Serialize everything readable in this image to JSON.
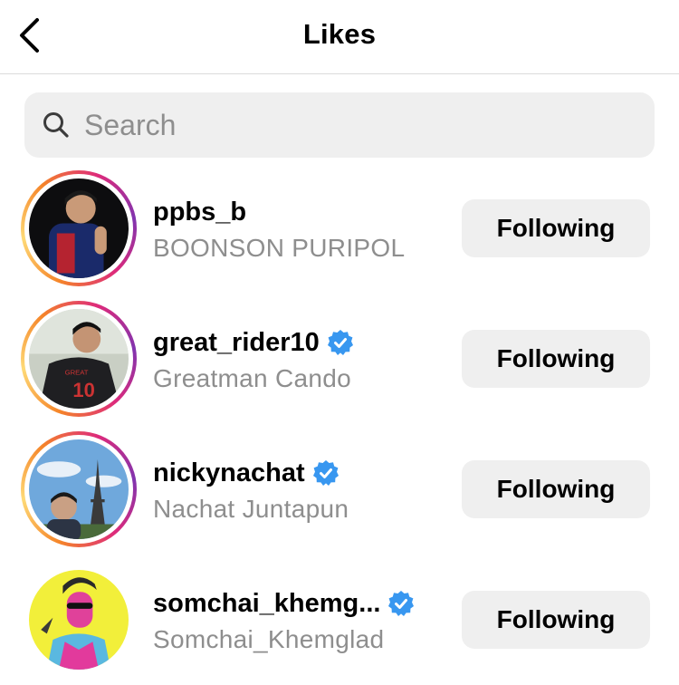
{
  "header": {
    "title": "Likes",
    "back_icon": "chevron-left-icon"
  },
  "search": {
    "placeholder": "Search",
    "value": "",
    "icon": "search-icon"
  },
  "colors": {
    "verified_blue": "#3897f0",
    "button_bg": "#efefef",
    "secondary_text": "#8e8e8e",
    "story_ring": [
      "#feda77",
      "#f58529",
      "#dd2a7b",
      "#8134af"
    ]
  },
  "users": [
    {
      "username": "ppbs_b",
      "full_name": "BOONSON PURIPOL",
      "verified": false,
      "has_story_ring": true,
      "button_label": "Following"
    },
    {
      "username": "great_rider10",
      "full_name": "Greatman Cando",
      "verified": true,
      "has_story_ring": true,
      "button_label": "Following"
    },
    {
      "username": "nickynachat",
      "full_name": "Nachat Juntapun",
      "verified": true,
      "has_story_ring": true,
      "button_label": "Following"
    },
    {
      "username": "somchai_khemg...",
      "full_name": "Somchai_Khemglad",
      "verified": true,
      "has_story_ring": false,
      "button_label": "Following"
    }
  ]
}
